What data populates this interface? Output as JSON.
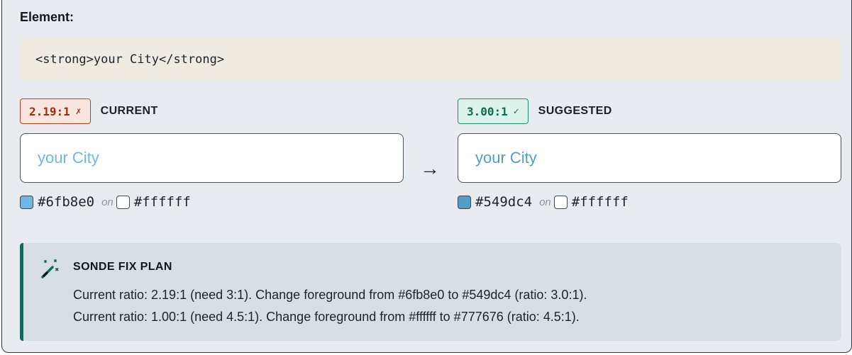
{
  "element": {
    "heading": "Element:",
    "code": "<strong>your City</strong>"
  },
  "current": {
    "ratio": "2.19:1",
    "mark": "✗",
    "label": "CURRENT",
    "preview_text": "your City",
    "fg_hex": "#6fb8e0",
    "bg_hex": "#ffffff",
    "on_word": "on",
    "fg_color": "#6fb8e0",
    "bg_color": "#ffffff"
  },
  "arrow": "→",
  "suggested": {
    "ratio": "3.00:1",
    "mark": "✓",
    "label": "SUGGESTED",
    "preview_text": "your City",
    "fg_hex": "#549dc4",
    "bg_hex": "#ffffff",
    "on_word": "on",
    "fg_color": "#549dc4",
    "bg_color": "#ffffff"
  },
  "fix_plan": {
    "icon": "magic-wand-icon",
    "title": "SONDE FIX PLAN",
    "lines": [
      "Current ratio: 2.19:1 (need 3:1). Change foreground from #6fb8e0 to #549dc4 (ratio: 3.0:1).",
      "Current ratio: 1.00:1 (need 4.5:1). Change foreground from #ffffff to #777676 (ratio: 4.5:1)."
    ]
  },
  "colors": {
    "fail_accent": "#b5421d",
    "pass_accent": "#1f8f73",
    "fix_plan_accent": "#16675d",
    "panel_background": "#e8ebef",
    "code_background": "#efebe2"
  }
}
